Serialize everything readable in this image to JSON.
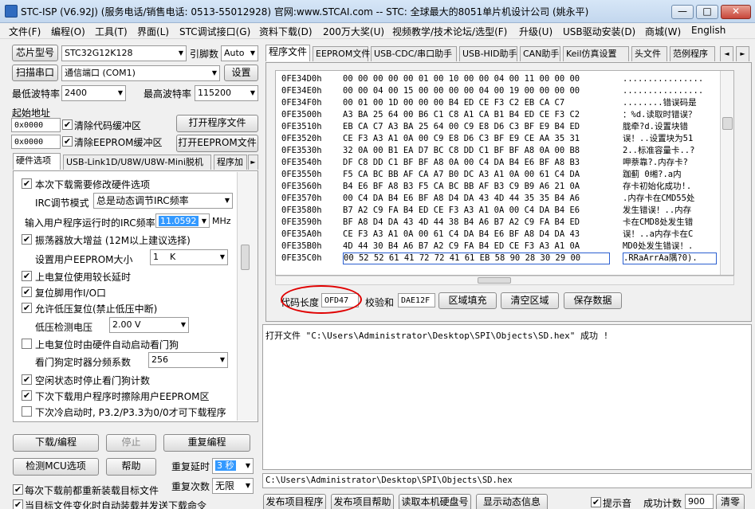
{
  "window": {
    "title": "STC-ISP (V6.92J) (服务电话/销售电话: 0513-55012928) 官网:www.STCAI.com  -- STC: 全球最大的8051单片机设计公司 (姚永平)",
    "min": "—",
    "max": "□",
    "close": "✕"
  },
  "menu": [
    "文件(F)",
    "编程(O)",
    "工具(T)",
    "界面(L)",
    "STC调试接口(G)",
    "资料下载(D)",
    "200万大奖(U)",
    "视频教学/技术论坛/选型(F)",
    "升级(U)",
    "USB驱动安装(D)",
    "商城(W)",
    "English"
  ],
  "left": {
    "chip_label": "芯片型号",
    "chip_value": "STC32G12K128",
    "pins_label": "引脚数",
    "pins_value": "Auto",
    "scan_button": "扫描串口",
    "port_value": "通信端口 (COM1)",
    "settings_button": "设置",
    "min_baud_label": "最低波特率",
    "min_baud_value": "2400",
    "max_baud_label": "最高波特率",
    "max_baud_value": "115200",
    "start_addr_label": "起始地址",
    "addr1": "0x0000",
    "clear_code": "清除代码缓冲区",
    "open_prog": "打开程序文件",
    "addr2": "0x0000",
    "clear_eeprom": "清除EEPROM缓冲区",
    "open_eeprom": "打开EEPROM文件",
    "tabs": [
      "硬件选项",
      "USB-Link1D/U8W/U8W-Mini脱机",
      "程序加"
    ],
    "opts": {
      "o1": "本次下载需要修改硬件选项",
      "irc_mode_label": "IRC调节模式",
      "irc_mode_value": "总是动态调节IRC频率",
      "freq_label": "输入用户程序运行时的IRC频率",
      "freq_value": "11.0592",
      "freq_unit": "MHz",
      "o2": "振荡器放大增益 (12M以上建议选择)",
      "eeprom_label": "设置用户EEPROM大小",
      "eeprom_value": "1    K",
      "o3": "上电复位使用较长延时",
      "o4": "复位脚用作I/O口",
      "o5": "允许低压复位(禁止低压中断)",
      "lv_label": "低压检测电压",
      "lv_value": "2.00 V",
      "o6": "上电复位时由硬件自动启动看门狗",
      "wdt_label": "看门狗定时器分频系数",
      "wdt_value": "256",
      "o7": "空闲状态时停止看门狗计数",
      "o8": "下次下载用户程序时擦除用户EEPROM区",
      "o9": "下次冷启动时, P3.2/P3.3为0/0才可下载程序"
    },
    "download": "下载/编程",
    "stop": "停止",
    "reprogram": "重复编程",
    "detect": "检测MCU选项",
    "help": "帮助",
    "repeat_delay_label": "重复延时",
    "repeat_delay_value": "3 秒",
    "repeat_count_label": "重复次数",
    "repeat_count_value": "无限",
    "reload_each": "每次下载前都重新装载目标文件",
    "auto_reload": "当目标文件变化时自动装载并发送下载命令"
  },
  "right": {
    "tabs": [
      "程序文件",
      "EEPROM文件",
      "USB-CDC/串口助手",
      "USB-HID助手",
      "CAN助手",
      "Keil仿真设置",
      "头文件",
      "范例程序"
    ],
    "tab_nav": [
      "◄",
      "►"
    ],
    "hex_rows": [
      {
        "a": "0FE34D0h",
        "h": "00 00 00 00 00 01 00 10 00 00 04 00 11 00 00 00",
        "t": "................"
      },
      {
        "a": "0FE34E0h",
        "h": "00 00 04 00 15 00 00 00 00 04 00 19 00 00 00 00",
        "t": "................"
      },
      {
        "a": "0FE34F0h",
        "h": "00 01 00 1D 00 00 00 B4 ED CE F3 C2 EB CA C7",
        "t": "........错误码是"
      },
      {
        "a": "0FE3500h",
        "h": "A3 BA 25 64 00 B6 C1 C8 A1 CA B1 B4 ED CE F3 C2",
        "t": "：%d.读取时错误？"
      },
      {
        "a": "0FE3510h",
        "h": "EB CA C7 A3 BA 25 64 00 C9 E8 D6 C3 BF E9 B4 ED",
        "t": "胧牵?d.设置块错"
      },
      {
        "a": "0FE3520h",
        "h": "CE F3 A3 A1 0A 00 C9 E8 D6 C3 BF E9 CE AA 35 31",
        "t": "误！..设置块为51"
      },
      {
        "a": "0FE3530h",
        "h": "32 0A 00 B1 EA D7 BC C8 DD C1 BF BF A8 0A 00 B8",
        "t": "2..标准容量卡..?"
      },
      {
        "a": "0FE3540h",
        "h": "DF C8 DD C1 BF BF A8 0A 00 C4 DA B4 E6 BF A8 B3",
        "t": "呷萘靠?.内存卡?"
      },
      {
        "a": "0FE3550h",
        "h": "F5 CA BC BB AF CA A7 B0 DC A3 A1 0A 00 61 C4 DA",
        "t": "跏蓟 0缃?.a内"
      },
      {
        "a": "0FE3560h",
        "h": "B4 E6 BF A8 B3 F5 CA BC BB AF B3 C9 B9 A6 21 0A",
        "t": "存卡初始化成功!."
      },
      {
        "a": "0FE3570h",
        "h": "00 C4 DA B4 E6 BF A8 D4 DA 43 4D 44 35 35 B4 A6",
        "t": ".内存卡在CMD55处"
      },
      {
        "a": "0FE3580h",
        "h": "B7 A2 C9 FA B4 ED CE F3 A3 A1 0A 00 C4 DA B4 E6",
        "t": "发生错误！..内存"
      },
      {
        "a": "0FE3590h",
        "h": "BF A8 D4 DA 43 4D 44 38 B4 A6 B7 A2 C9 FA B4 ED",
        "t": "卡在CMD8处发生错"
      },
      {
        "a": "0FE35A0h",
        "h": "CE F3 A3 A1 0A 00 61 C4 DA B4 E6 BF A8 D4 DA 43",
        "t": "误！..a内存卡在C"
      },
      {
        "a": "0FE35B0h",
        "h": "4D 44 30 B4 A6 B7 A2 C9 FA B4 ED CE F3 A3 A1 0A",
        "t": "MD0处发生错误！."
      },
      {
        "a": "0FE35C0h",
        "h": "00 52 52 61 41 72 72 41 61 EB 58 90 28 30 29 00",
        "t": ".RRaArrAa隅?0)."
      }
    ],
    "code_len_label": "代码长度",
    "code_len_value": "OFD47",
    "checksum_label": "校验和",
    "checksum_value": "DAE12F",
    "fill_button": "区域填充",
    "clear_button": "清空区域",
    "save_button": "保存数据",
    "log_text": "打开文件 \"C:\\Users\\Administrator\\Desktop\\SPI\\Objects\\SD.hex\" 成功 !",
    "path": "C:\\Users\\Administrator\\Desktop\\SPI\\Objects\\SD.hex",
    "publish": "发布项目程序",
    "publish_help": "发布项目帮助",
    "read_serial": "读取本机硬盘号",
    "show_dynamic": "显示动态信息",
    "beep": "提示音",
    "success_label": "成功计数",
    "success_value": "900",
    "clear_count": "清零"
  },
  "colors": {
    "accent": "#3399ff",
    "annotation": "#e00000"
  }
}
